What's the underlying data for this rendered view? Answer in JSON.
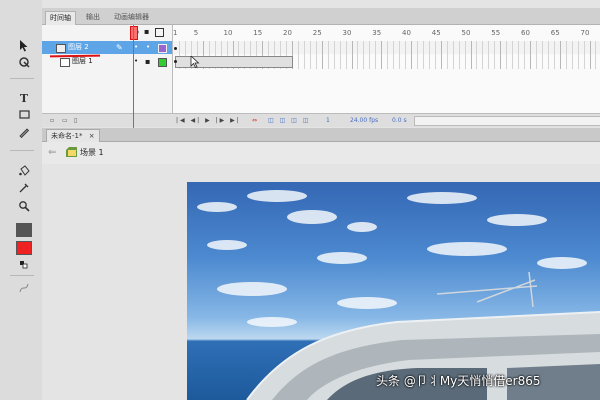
{
  "timeline": {
    "tabs": [
      {
        "label": "时间轴"
      },
      {
        "label": "输出"
      },
      {
        "label": "动画编辑器"
      }
    ],
    "ruler": [
      "1",
      "5",
      "10",
      "15",
      "20",
      "25",
      "30",
      "35",
      "40",
      "45",
      "50",
      "55",
      "60",
      "65",
      "70"
    ],
    "layers": [
      {
        "name": "图层 2",
        "selected": true,
        "color": "#9966cc"
      },
      {
        "name": "图层 1",
        "selected": false,
        "color": "#33cc33"
      }
    ],
    "status": {
      "frame": "1",
      "fps": "24.00 fps",
      "time": "0.0 s"
    }
  },
  "document": {
    "tab_label": "未命名-1*",
    "close_glyph": "×",
    "scene_label": "场景 1"
  },
  "tools": [
    "selection-arrow",
    "subselection",
    "text",
    "rectangle",
    "pencil",
    "paint-bucket",
    "eyedropper",
    "zoom"
  ],
  "colors": {
    "stroke": "#555555",
    "fill": "#ee2222",
    "selection": "#5ea5e8",
    "playhead": "#ff3b3b",
    "annotation": "#dd1111"
  },
  "watermark": "头条 @卩丬My天悄悄借er865"
}
